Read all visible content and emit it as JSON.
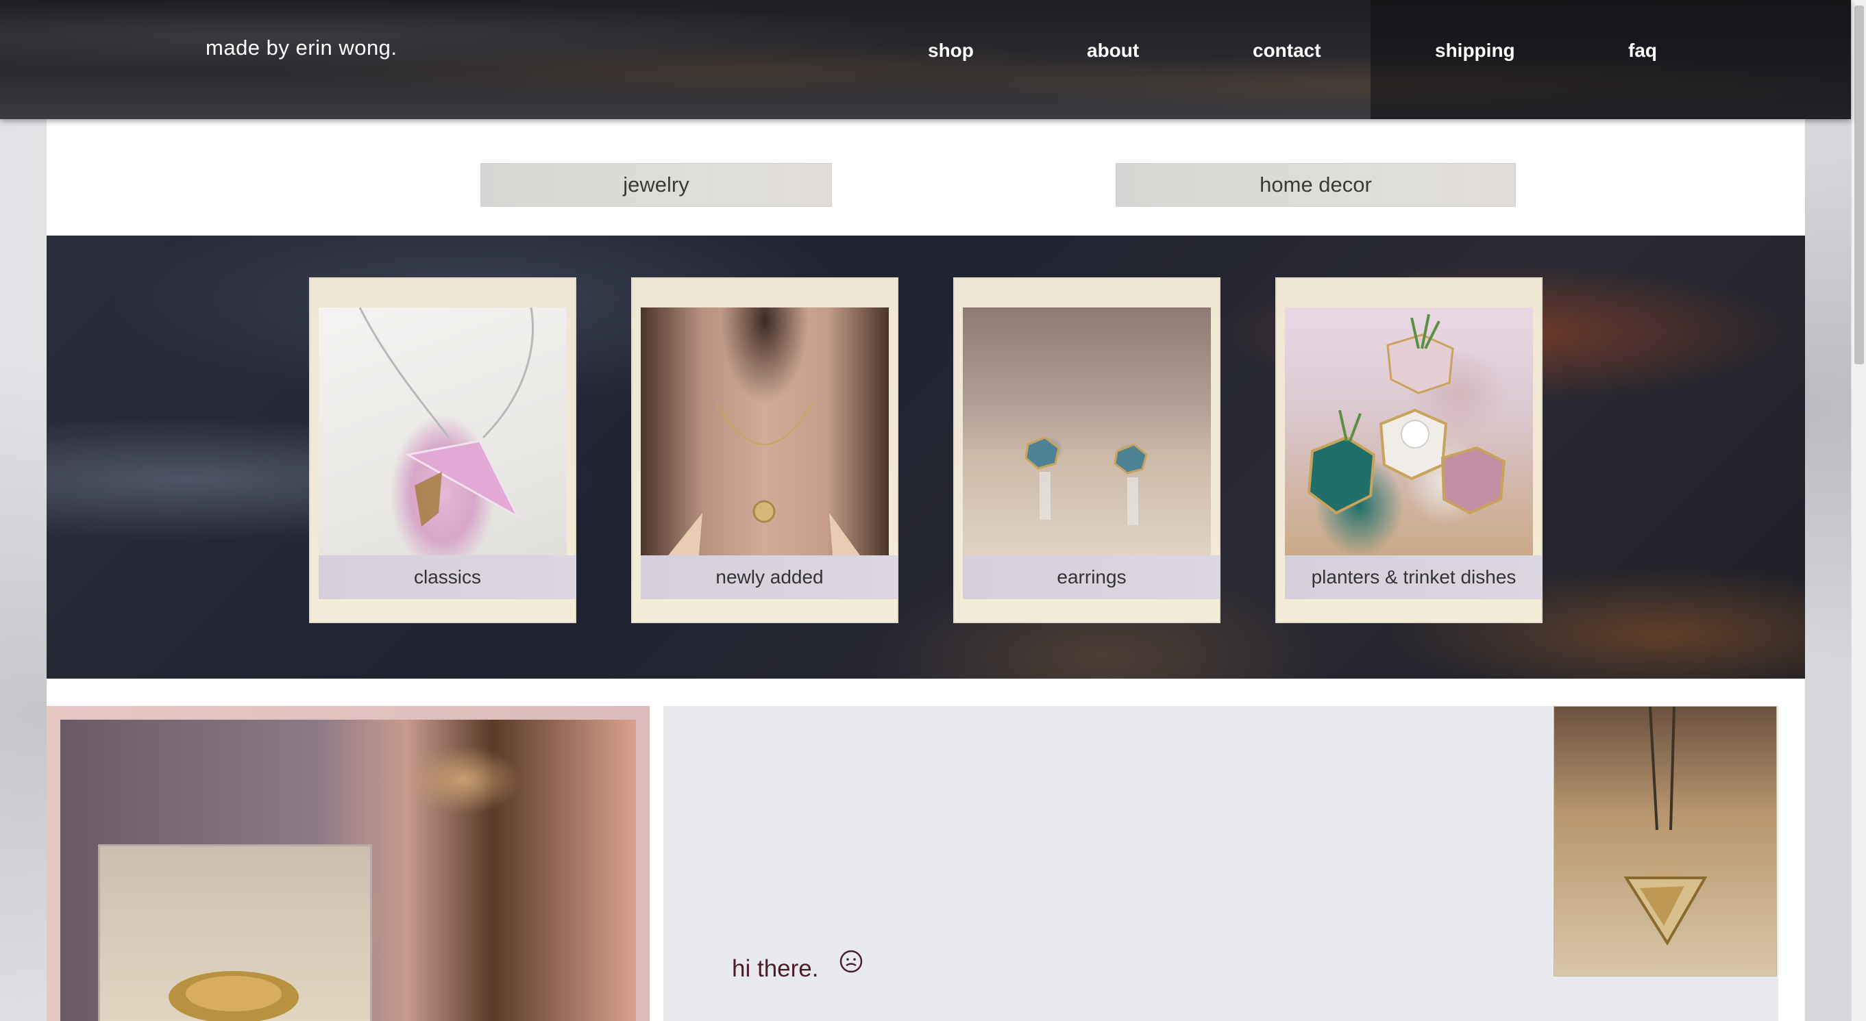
{
  "header": {
    "logo": "made by erin wong.",
    "nav": [
      {
        "label": "shop"
      },
      {
        "label": "about"
      },
      {
        "label": "contact"
      },
      {
        "label": "shipping"
      },
      {
        "label": "faq"
      }
    ]
  },
  "categories": [
    {
      "label": "jewelry"
    },
    {
      "label": "home decor"
    }
  ],
  "collections": [
    {
      "label": "classics"
    },
    {
      "label": "newly added"
    },
    {
      "label": "earrings"
    },
    {
      "label": "planters & trinket dishes"
    }
  ],
  "intro": {
    "greeting": "hi there."
  }
}
